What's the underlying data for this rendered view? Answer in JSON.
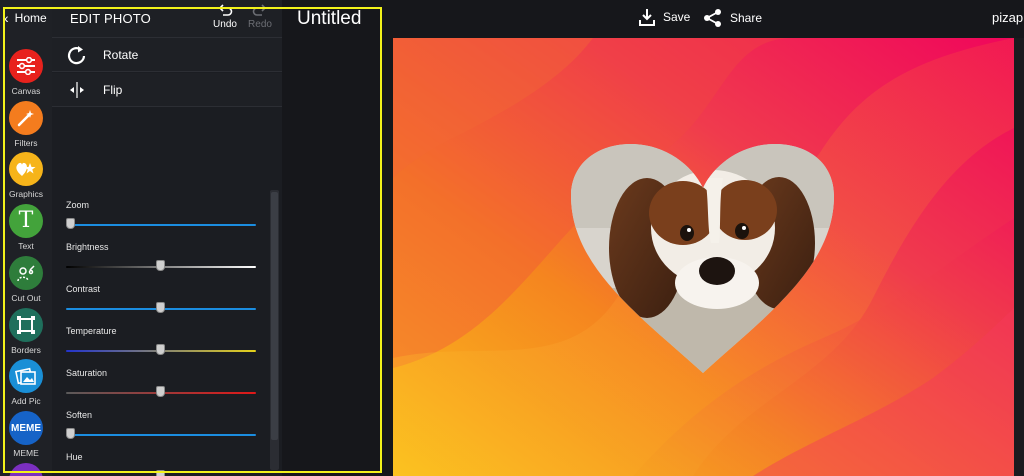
{
  "nav": {
    "home_label": "Home"
  },
  "rail": {
    "items": [
      {
        "label": "Canvas",
        "color": "#e8221d"
      },
      {
        "label": "Filters",
        "color": "#f47c1e"
      },
      {
        "label": "Graphics",
        "color": "#f6b41a"
      },
      {
        "label": "Text",
        "color": "#43a33b"
      },
      {
        "label": "Cut Out",
        "color": "#2e7d3b"
      },
      {
        "label": "Borders",
        "color": "#1f6f5c"
      },
      {
        "label": "Add Pic",
        "color": "#1a8fd6"
      },
      {
        "label": "MEME",
        "color": "#1663c7",
        "icon_text": "MEME"
      }
    ]
  },
  "panel": {
    "title": "EDIT PHOTO",
    "undo_label": "Undo",
    "redo_label": "Redo",
    "rows": [
      {
        "label": "Rotate"
      },
      {
        "label": "Flip"
      }
    ],
    "sliders": [
      {
        "label": "Zoom",
        "value": 0,
        "gradient": [
          "#1b8de0",
          "#1b8de0"
        ]
      },
      {
        "label": "Brightness",
        "value": 0.5,
        "gradient": [
          "#000000",
          "#ffffff"
        ]
      },
      {
        "label": "Contrast",
        "value": 0.5,
        "gradient": [
          "#1b8de0",
          "#1b8de0"
        ]
      },
      {
        "label": "Temperature",
        "value": 0.5,
        "gradient": [
          "#2233cc",
          "#e6d21a"
        ]
      },
      {
        "label": "Saturation",
        "value": 0.5,
        "gradient": [
          "#5a5a5a",
          "#e01818"
        ]
      },
      {
        "label": "Soften",
        "value": 0,
        "gradient": [
          "#1b8de0",
          "#1b8de0"
        ]
      },
      {
        "label": "Hue",
        "value": 0.5,
        "gradient": [
          "#1b8de0",
          "#1b8de0"
        ]
      }
    ]
  },
  "header": {
    "doc_title": "Untitled",
    "save_label": "Save",
    "share_label": "Share",
    "brand": "pizap"
  },
  "colors": {
    "highlight": "#f2f21a",
    "canvas_gradient": [
      "#fbbf1d",
      "#f5851f",
      "#f03b4d",
      "#f0065b"
    ]
  }
}
